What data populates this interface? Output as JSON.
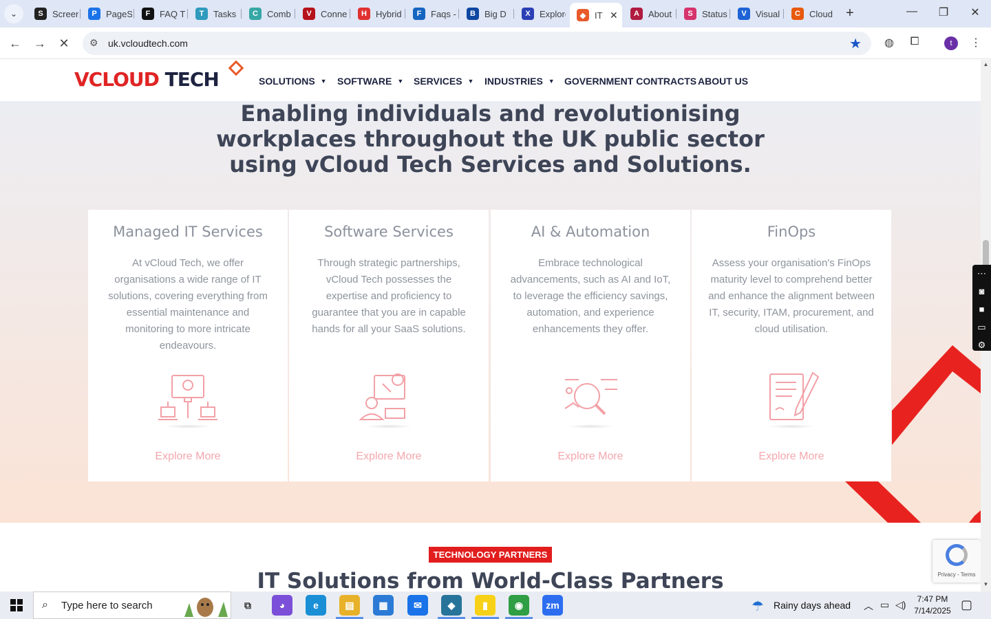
{
  "browser": {
    "tabs": [
      {
        "title": "Screen",
        "icon": "screencast-icon",
        "color": "#222222",
        "glyph": "S"
      },
      {
        "title": "PageSpeed",
        "icon": "pagespeed-icon",
        "color": "#1a73e8",
        "glyph": "P"
      },
      {
        "title": "FAQ T",
        "icon": "faq-icon",
        "color": "#111111",
        "glyph": "F"
      },
      {
        "title": "Tasks",
        "icon": "tasks-icon",
        "color": "#2f9bbd",
        "glyph": "T"
      },
      {
        "title": "Comb",
        "icon": "comb-icon",
        "color": "#36a7a5",
        "glyph": "C"
      },
      {
        "title": "Connect",
        "icon": "connect-icon",
        "color": "#b5121b",
        "glyph": "V"
      },
      {
        "title": "Hybrid",
        "icon": "hybrid-icon",
        "color": "#e03131",
        "glyph": "H"
      },
      {
        "title": "Faqs -",
        "icon": "faqs-icon",
        "color": "#1565c0",
        "glyph": "F"
      },
      {
        "title": "Big D",
        "icon": "bigd-icon",
        "color": "#0d47a1",
        "glyph": "B"
      },
      {
        "title": "Explore",
        "icon": "explore-icon",
        "color": "#2b3fb5",
        "glyph": "X"
      },
      {
        "title": "IT",
        "icon": "vcloud-favicon-icon",
        "color": "#e85a2a",
        "glyph": "◆",
        "active": true
      },
      {
        "title": "About",
        "icon": "about-icon",
        "color": "#b01b3f",
        "glyph": "A"
      },
      {
        "title": "Status",
        "icon": "status-icon",
        "color": "#d6336c",
        "glyph": "S"
      },
      {
        "title": "Visual",
        "icon": "visual-icon",
        "color": "#1e63d6",
        "glyph": "V"
      },
      {
        "title": "Cloud",
        "icon": "cloud-icon",
        "color": "#e8590c",
        "glyph": "C"
      }
    ],
    "close_tab_glyph": "✕",
    "new_tab_glyph": "+",
    "url": "uk.vcloudtech.com",
    "profile_initial": "t"
  },
  "site": {
    "logo": {
      "v": "V",
      "cloud": "CLOUD",
      "tech": " TECH"
    },
    "nav": [
      {
        "label": "SOLUTIONS",
        "dropdown": true
      },
      {
        "label": "SOFTWARE",
        "dropdown": true
      },
      {
        "label": "SERVICES",
        "dropdown": true
      },
      {
        "label": "INDUSTRIES",
        "dropdown": true
      },
      {
        "label": "GOVERNMENT CONTRACTS",
        "dropdown": false
      },
      {
        "label": "ABOUT US",
        "dropdown": false
      }
    ],
    "hero_title": "Enabling individuals and revolutionising workplaces throughout the UK public sector using vCloud Tech Services and Solutions.",
    "cards": [
      {
        "title": "Managed IT Services",
        "description": "At vCloud Tech, we offer organisations a wide range of IT solutions, covering everything from essential maintenance and monitoring to more intricate endeavours.",
        "icon": "managed-it-network-icon",
        "link": "Explore More"
      },
      {
        "title": "Software Services",
        "description": "Through strategic partnerships, vCloud Tech possesses the expertise and proficiency to guarantee that you are in capable hands for all your SaaS solutions.",
        "icon": "software-developer-icon",
        "link": "Explore More"
      },
      {
        "title": "AI & Automation",
        "description": "Embrace technological advancements, such as AI and IoT, to leverage the efficiency savings, automation, and experience enhancements they offer.",
        "icon": "ai-analysis-icon",
        "link": "Explore More"
      },
      {
        "title": "FinOps",
        "description": "Assess your organisation's FinOps maturity level to comprehend better and enhance the alignment between IT, security, ITAM, procurement, and cloud utilisation.",
        "icon": "finops-document-pen-icon",
        "link": "Explore More"
      }
    ],
    "partners_badge": "TECHNOLOGY PARTNERS",
    "partners_title": "IT Solutions from World-Class Partners",
    "recaptcha_text": "Privacy - Terms"
  },
  "taskbar": {
    "search_placeholder": "Type here to search",
    "apps": [
      {
        "name": "task-view",
        "glyph": "⧉",
        "color": "#333333"
      },
      {
        "name": "copilot",
        "glyph": "◕",
        "color": "#7b4fd8"
      },
      {
        "name": "edge",
        "glyph": "e",
        "color": "#1a8fd6"
      },
      {
        "name": "file-explorer",
        "glyph": "▤",
        "color": "#e8b12a"
      },
      {
        "name": "microsoft-store",
        "glyph": "▦",
        "color": "#2b7bd6"
      },
      {
        "name": "mail",
        "glyph": "✉",
        "color": "#1a73e8"
      },
      {
        "name": "app-diamond",
        "glyph": "◆",
        "color": "#27749a"
      },
      {
        "name": "sticky-notes",
        "glyph": "▮",
        "color": "#f7d117"
      },
      {
        "name": "chrome",
        "glyph": "◉",
        "color": "#2f9e44"
      },
      {
        "name": "zoom",
        "glyph": "zm",
        "color": "#2d6ef0"
      }
    ],
    "weather": "Rainy days ahead",
    "time": "7:47 PM",
    "date": "7/14/2025"
  },
  "colors": {
    "brand_red": "#e02424",
    "brand_navy": "#1d2340",
    "link_pink": "#f4a7ad",
    "hero_text": "#3e4557"
  }
}
